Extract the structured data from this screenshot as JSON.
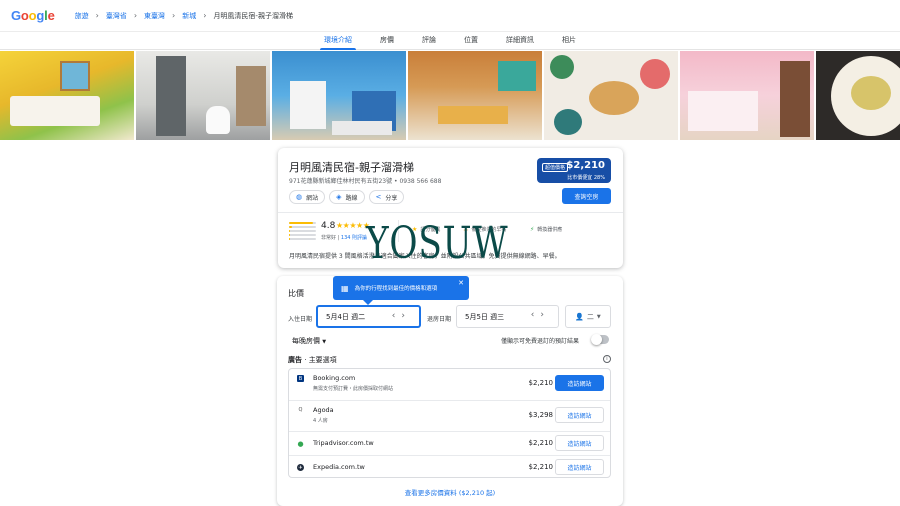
{
  "topbar": {
    "logo_letters": [
      "G",
      "o",
      "o",
      "g",
      "l",
      "e"
    ],
    "breadcrumbs": [
      "旅遊",
      "臺灣省",
      "東臺灣",
      "新城"
    ],
    "current_page": "月明風清民宿-親子溜滑梯"
  },
  "tabs": [
    "環境介紹",
    "房價",
    "評論",
    "位置",
    "詳細資訊",
    "相片"
  ],
  "photos": [
    {
      "name": "yellow-bedroom-photo"
    },
    {
      "name": "bathroom-photo"
    },
    {
      "name": "castle-bunk-room-photo"
    },
    {
      "name": "dining-lounge-photo"
    },
    {
      "name": "breakfast-photo"
    },
    {
      "name": "pink-slide-room-photo"
    },
    {
      "name": "fruit-plate-photo"
    }
  ],
  "hotel": {
    "name": "月明風清民宿-親子溜滑梯",
    "address": "971花蓮縣新城鄉佳林村民有五街23號 • 0938 566 688",
    "chips": [
      "網站",
      "路線",
      "分享"
    ],
    "deal_badge": "超值價格",
    "price": "$2,210",
    "price_compare": "比市價便宜 28%",
    "check_btn": "查詢空房",
    "rating": "4.8",
    "stars": "★★★★★",
    "rating_label": "非常好",
    "review_count": "134 則評論",
    "highlights": [
      "評分優異",
      "備受推崇的早餐",
      "轉換器供應"
    ],
    "description": "月明風清民宿提供 3 間風格活潑且適合闔家入住的客房，並附設公共區域，免費提供無線網路、早餐。",
    "rating_fill": [
      0.9,
      0.12,
      0.05,
      0.03,
      0.03
    ]
  },
  "prices": {
    "title": "比價",
    "checkin_label": "入住日期",
    "checkin_value": "5月4日 週二",
    "checkout_label": "退房日期",
    "checkout_value": "5月5日 週三",
    "guests": "二",
    "tooltip": "為你的行程找到最佳的價格和選項",
    "nightly_label": "每晚房價",
    "free_cancel_label": "僅顯示可免費退訂的預訂結果",
    "ads_prefix": "廣告",
    "ads_label": "主要選項",
    "providers": [
      {
        "name": "Booking.com",
        "sub": "無需支付預訂費・此房價採取付網站",
        "price": "$2,210",
        "visit": "造訪網站",
        "color": "#003580",
        "icon": "B"
      },
      {
        "name": "Agoda",
        "sub": "4 人房",
        "price": "$3,298",
        "visit": "造訪網站",
        "color": "#ffffff",
        "icon": "Q"
      },
      {
        "name": "Tripadvisor.com.tw",
        "sub": "",
        "price": "$2,210",
        "visit": "造訪網站",
        "color": "#34e0a1",
        "icon": "●"
      },
      {
        "name": "Expedia.com.tw",
        "sub": "",
        "price": "$2,210",
        "visit": "造訪網站",
        "color": "#1f2b3d",
        "icon": "✈"
      }
    ],
    "more_link": "查看更多房價資料 ($2,210 起)"
  },
  "watermark": "YOSUW",
  "colors": {
    "accent": "#1a73e8",
    "badge": "#174ea6",
    "star": "#fbbc04"
  }
}
